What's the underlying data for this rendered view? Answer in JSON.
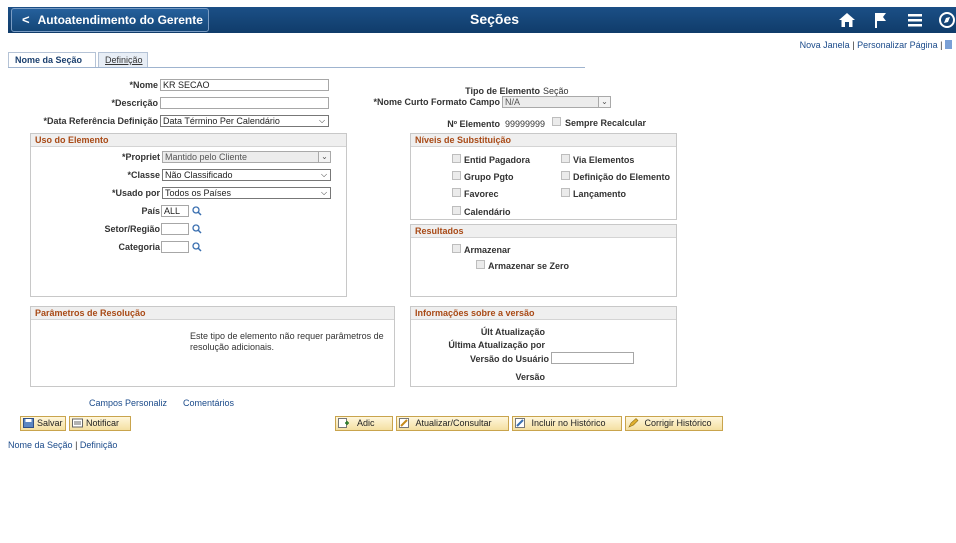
{
  "header": {
    "back_label": "Autoatendimento do Gerente",
    "title": "Seções",
    "icons": [
      "home-icon",
      "flag-icon",
      "menu-icon",
      "navbar-icon"
    ]
  },
  "top_links": {
    "new_window": "Nova Janela",
    "separator": "|",
    "personalize": "Personalizar Página",
    "separator2": "|"
  },
  "tabs": [
    {
      "label": "Nome da Seção",
      "active": true
    },
    {
      "label": "Definição",
      "active": false
    }
  ],
  "form": {
    "nome_label": "*Nome",
    "nome_value": "KR SECAO",
    "descricao_label": "*Descrição",
    "descricao_value": "",
    "data_ref_label": "*Data Referência Definição",
    "data_ref_value": "Data Término Per Calendário",
    "tipo_label": "Tipo de Elemento",
    "tipo_value": "Seção",
    "nome_curto_label": "*Nome Curto Formato Campo",
    "nome_curto_value": "N/A",
    "n_elemento_label": "Nº Elemento",
    "n_elemento_value": "99999999",
    "sempre_recalcular_label": "Sempre Recalcular"
  },
  "uso": {
    "title": "Uso do Elemento",
    "propriet_label": "*Propriet",
    "propriet_value": "Mantido pelo Cliente",
    "classe_label": "*Classe",
    "classe_value": "Não Classificado",
    "usado_label": "*Usado por",
    "usado_value": "Todos os Países",
    "pais_label": "País",
    "pais_value": "ALL",
    "setor_label": "Setor/Região",
    "setor_value": "",
    "categoria_label": "Categoria",
    "categoria_value": ""
  },
  "niveis": {
    "title": "Níveis de Substituição",
    "items": [
      "Entid Pagadora",
      "Via Elementos",
      "Grupo Pgto",
      "Definição do Elemento",
      "Favorec",
      "Lançamento",
      "Calendário"
    ]
  },
  "resultados": {
    "title": "Resultados",
    "armazenar": "Armazenar",
    "armazenar_zero": "Armazenar se Zero"
  },
  "parametros": {
    "title": "Parâmetros de Resolução",
    "text_line1": "Este tipo de elemento não requer parâmetros de",
    "text_line2": "resolução adicionais."
  },
  "versao": {
    "title": "Informações sobre a versão",
    "ult_atualizacao": "Últ Atualização",
    "ultima_por": "Última Atualização por",
    "versao_usuario": "Versão do Usuário",
    "versao_usuario_value": "",
    "versao": "Versão"
  },
  "links": {
    "campos": "Campos Personaliz",
    "comentarios": "Comentários"
  },
  "buttons": {
    "salvar": "Salvar",
    "notificar": "Notificar",
    "adic": "Adic",
    "atualizar": "Atualizar/Consultar",
    "incluir": "Incluir no Histórico",
    "corrigir": "Corrigir Histórico"
  },
  "footer": {
    "link1": "Nome da Seção",
    "sep": "|",
    "link2": "Definição"
  }
}
